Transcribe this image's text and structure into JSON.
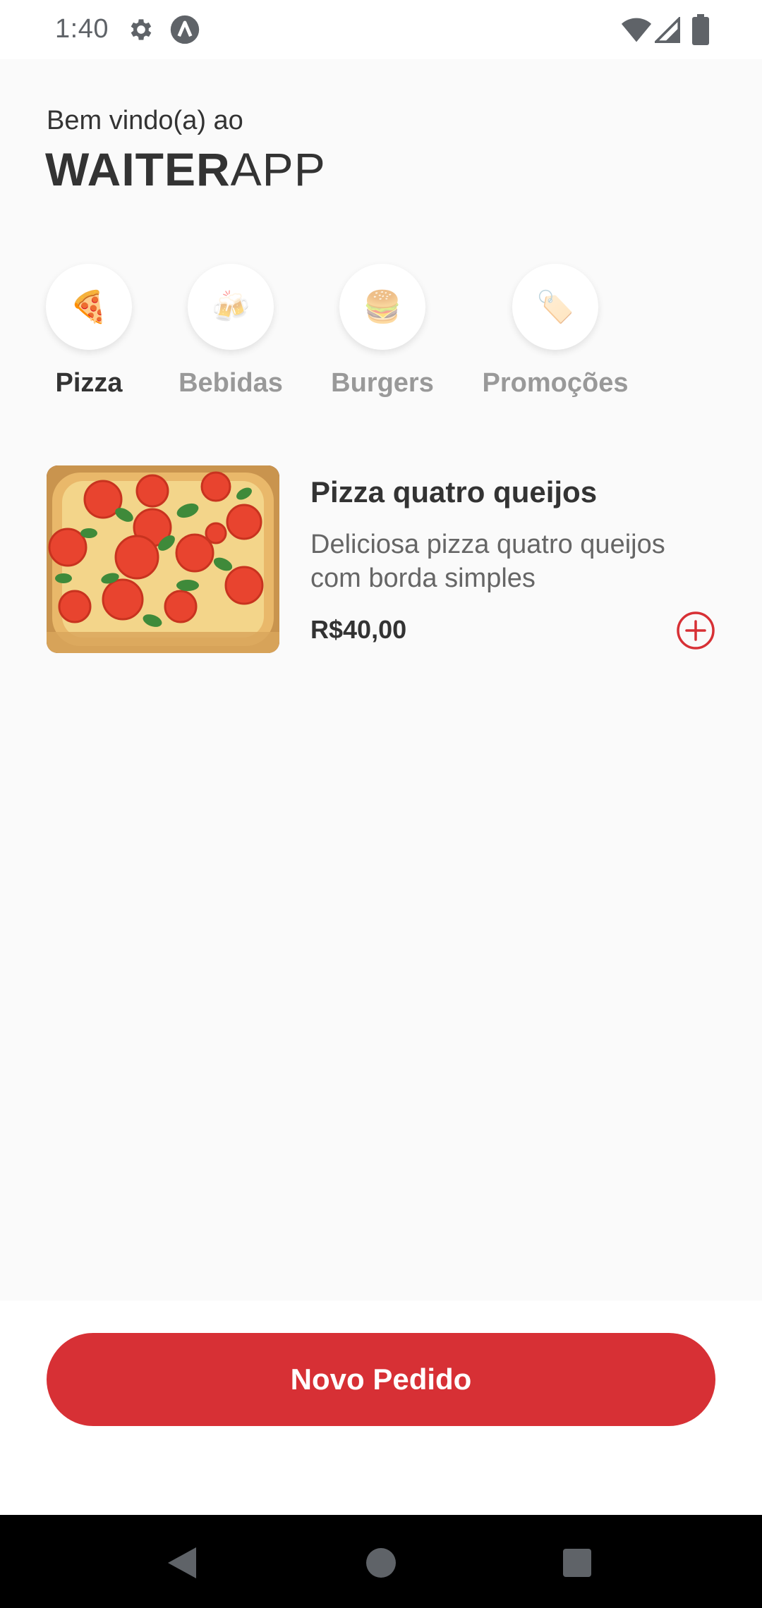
{
  "status_bar": {
    "time": "1:40",
    "icons": [
      "gear-icon",
      "a-icon",
      "wifi-icon",
      "signal-icon",
      "battery-icon"
    ]
  },
  "header": {
    "welcome": "Bem vindo(a) ao",
    "brand_bold": "WAITER",
    "brand_light": "APP"
  },
  "categories": [
    {
      "label": "Pizza",
      "icon": "🍕",
      "active": true
    },
    {
      "label": "Bebidas",
      "icon": "🍻",
      "active": false
    },
    {
      "label": "Burgers",
      "icon": "🍔",
      "active": false
    },
    {
      "label": "Promoções",
      "icon": "🏷️",
      "active": false
    }
  ],
  "product": {
    "name": "Pizza quatro queijos",
    "description": "Deliciosa pizza quatro queijos com borda simples",
    "price": "R$40,00"
  },
  "footer": {
    "new_order_label": "Novo Pedido"
  },
  "colors": {
    "accent": "#d73035",
    "text_primary": "#333333",
    "text_muted": "#999999",
    "background": "#fafafa"
  }
}
